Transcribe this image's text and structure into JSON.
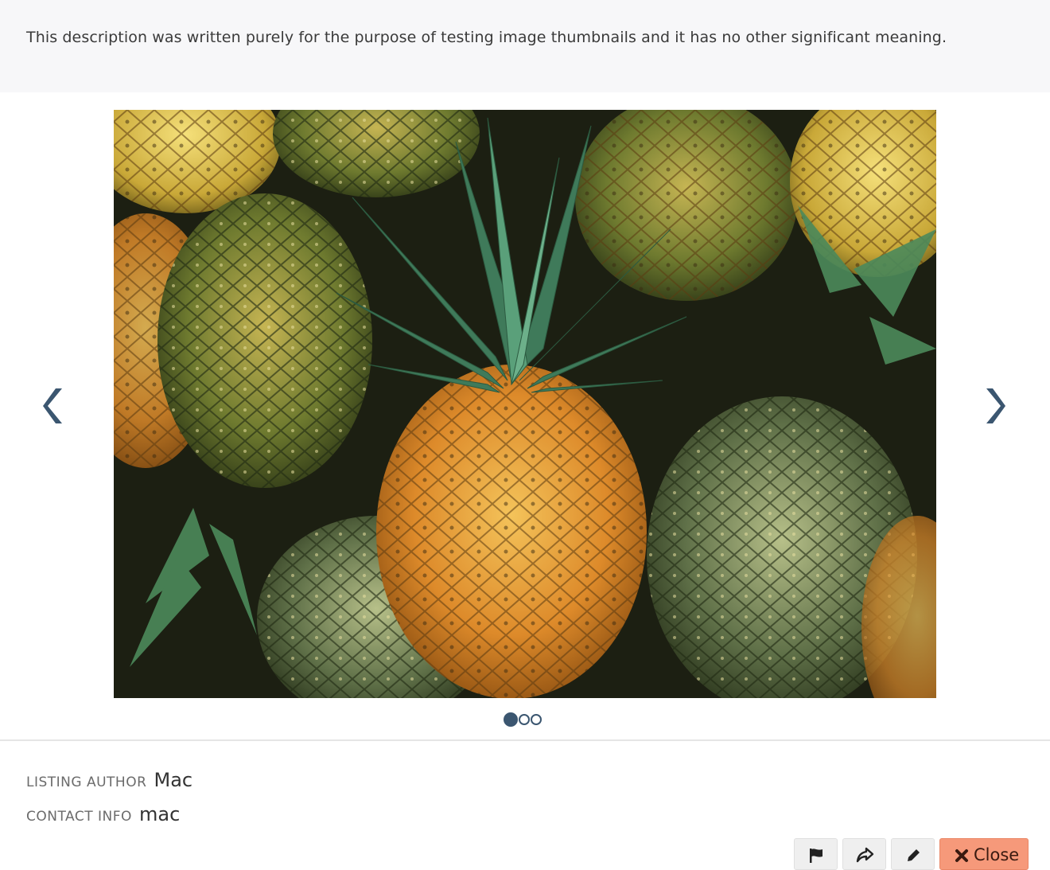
{
  "listing": {
    "description": "This description was written purely for the purpose of testing image thumbnails and it has no other significant meaning."
  },
  "carousel": {
    "slide_count": 3,
    "active_index": 0,
    "accent_color": "#3b5670"
  },
  "meta": {
    "author_label": "LISTING AUTHOR",
    "author_value": "Mac",
    "contact_label": "CONTACT INFO",
    "contact_value": "mac"
  },
  "actions": {
    "flag_icon": "flag-icon",
    "share_icon": "share-icon",
    "edit_icon": "pencil-icon",
    "close_icon": "x-icon",
    "close_label": "Close",
    "close_color": "#f6997a"
  }
}
